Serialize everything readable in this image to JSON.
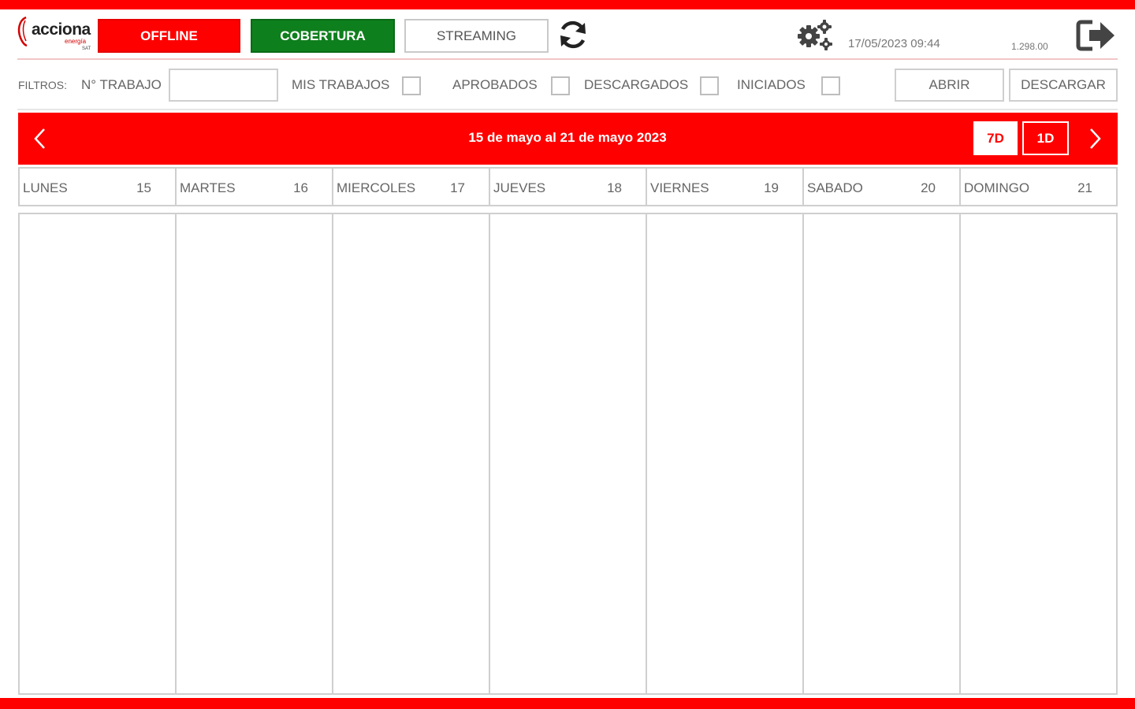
{
  "brand": {
    "name": "acciona",
    "sub": "energía",
    "sub2": "SAT",
    "accent": "#ff0000"
  },
  "header": {
    "offline_label": "OFFLINE",
    "cobertura_label": "COBERTURA",
    "streaming_label": "STREAMING",
    "datetime": "17/05/2023 09:44",
    "version": "1.298.00",
    "icons": [
      "refresh-icon",
      "settings-gears-icon",
      "logout-icon"
    ]
  },
  "filters": {
    "label": "FILTROS:",
    "n_trabajo_label": "N° TRABAJO",
    "n_trabajo_value": "",
    "checks": [
      {
        "label": "MIS TRABAJOS",
        "checked": false
      },
      {
        "label": "APROBADOS",
        "checked": false
      },
      {
        "label": "DESCARGADOS",
        "checked": false
      },
      {
        "label": "INICIADOS",
        "checked": false
      }
    ],
    "abrir_label": "ABRIR",
    "descargar_label": "DESCARGAR"
  },
  "week": {
    "title": "15 de mayo al 21 de mayo 2023",
    "view_7d": "7D",
    "view_1d": "1D"
  },
  "days": [
    {
      "name": "LUNES",
      "date": "15"
    },
    {
      "name": "MARTES",
      "date": "16"
    },
    {
      "name": "MIERCOLES",
      "date": "17"
    },
    {
      "name": "JUEVES",
      "date": "18"
    },
    {
      "name": "VIERNES",
      "date": "19"
    },
    {
      "name": "SABADO",
      "date": "20"
    },
    {
      "name": "DOMINGO",
      "date": "21"
    }
  ]
}
